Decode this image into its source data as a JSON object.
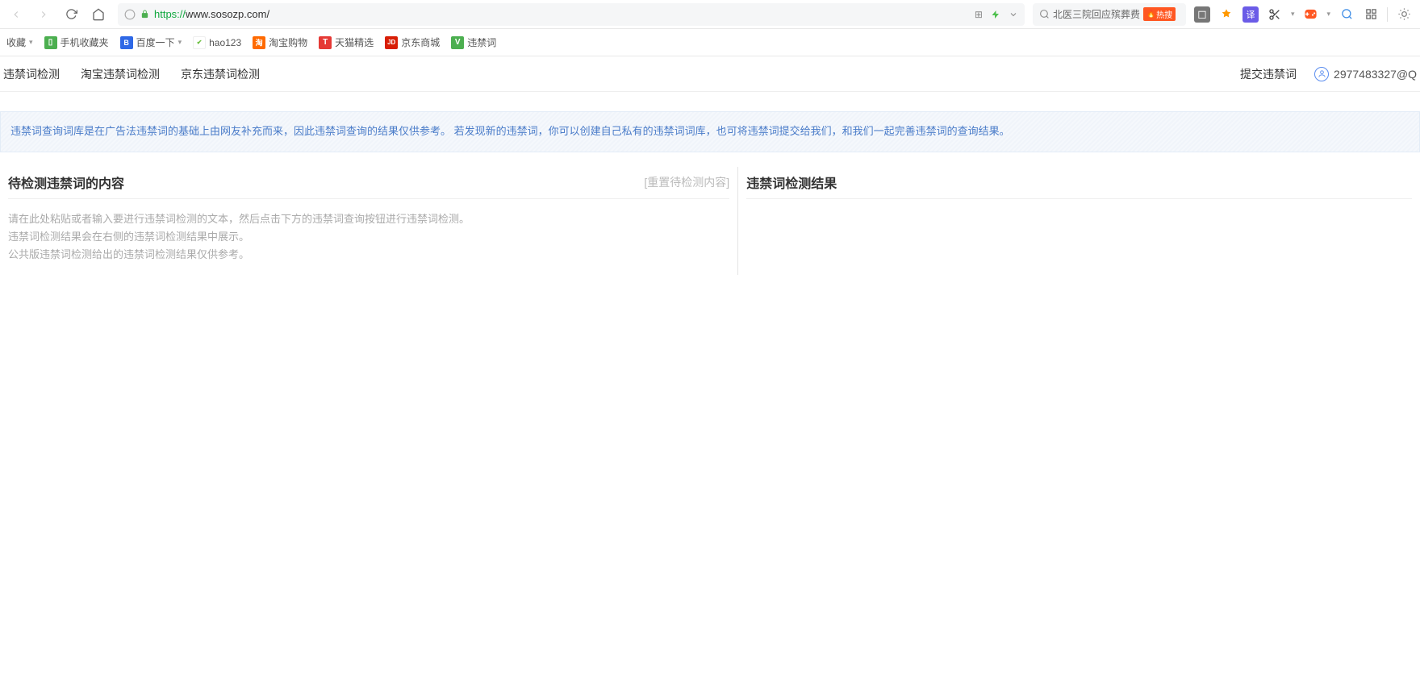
{
  "browser": {
    "url_protocol": "https://",
    "url_rest": "www.sosozp.com/",
    "search_suggest": "北医三院回应殡葬费",
    "hot_label": "热搜"
  },
  "bookmarks": {
    "favorites_label": "收藏",
    "items": [
      {
        "label": "手机收藏夹"
      },
      {
        "label": "百度一下"
      },
      {
        "label": "hao123"
      },
      {
        "label": "淘宝购物"
      },
      {
        "label": "天猫精选"
      },
      {
        "label": "京东商城"
      },
      {
        "label": "违禁词"
      }
    ]
  },
  "page_nav": {
    "tabs": [
      "违禁词检测",
      "淘宝违禁词检测",
      "京东违禁词检测"
    ],
    "submit_label": "提交违禁词",
    "user": "2977483327@Q"
  },
  "notice_text": "违禁词查询词库是在广告法违禁词的基础上由网友补充而来，因此违禁词查询的结果仅供参考。 若发现新的违禁词，你可以创建自己私有的违禁词词库，也可将违禁词提交给我们，和我们一起完善违禁词的查询结果。",
  "left_panel": {
    "title": "待检测违禁词的内容",
    "reset": "[重置待检测内容]",
    "placeholder": "请在此处粘贴或者输入要进行违禁词检测的文本，然后点击下方的违禁词查询按钮进行违禁词检测。\n违禁词检测结果会在右侧的违禁词检测结果中展示。\n公共版违禁词检测给出的违禁词检测结果仅供参考。"
  },
  "right_panel": {
    "title": "违禁词检测结果"
  }
}
